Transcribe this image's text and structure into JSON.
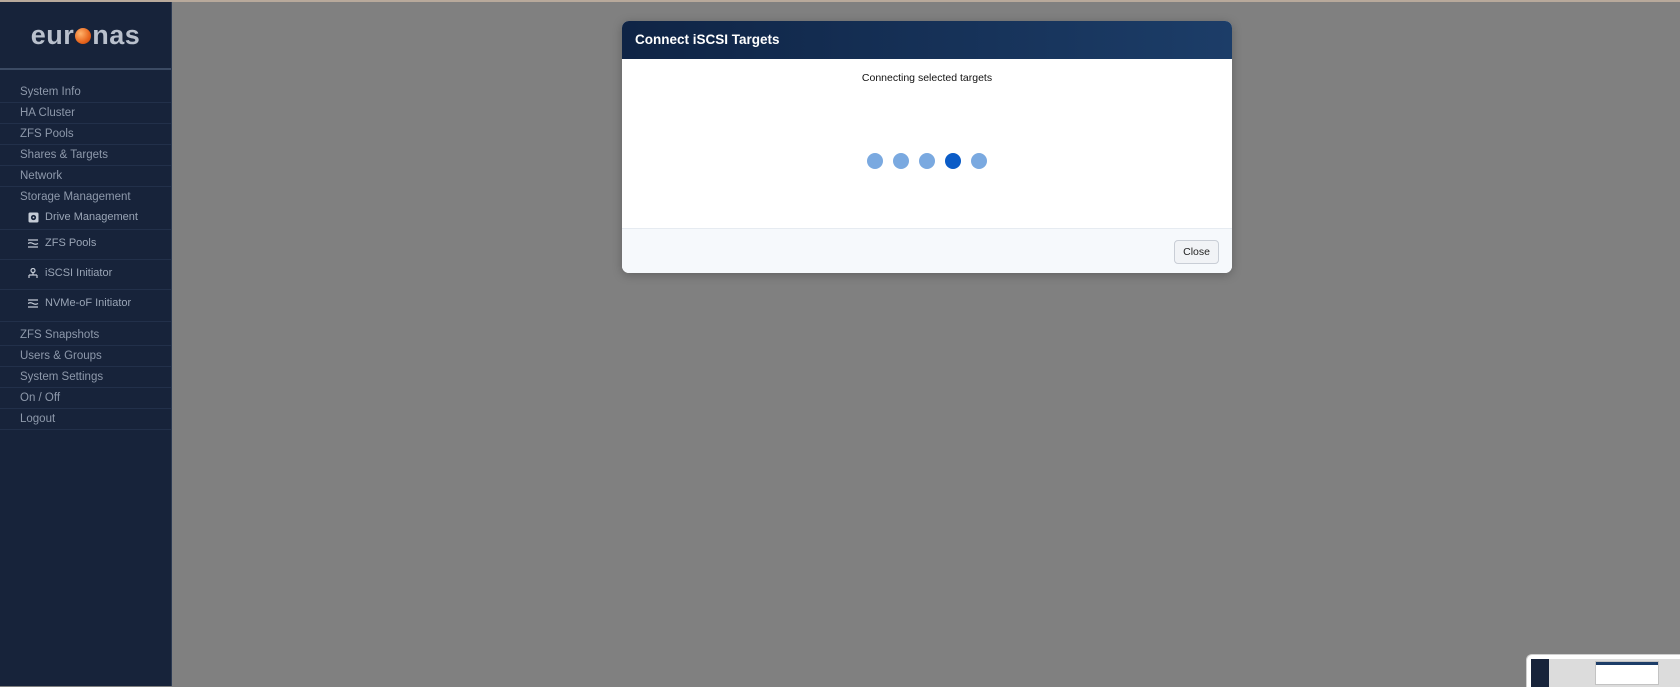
{
  "brand": {
    "logo_left": "eur",
    "logo_right": "nas"
  },
  "sidebar": {
    "items": [
      {
        "label": "System Info"
      },
      {
        "label": "HA Cluster"
      },
      {
        "label": "ZFS Pools"
      },
      {
        "label": "Shares & Targets"
      },
      {
        "label": "Network"
      },
      {
        "label": "Storage Management"
      }
    ],
    "subitems": [
      {
        "label": "Drive Management",
        "icon": "drive-icon"
      },
      {
        "label": "ZFS Pools",
        "icon": "layers-icon"
      },
      {
        "label": "iSCSI Initiator",
        "icon": "initiator-icon"
      },
      {
        "label": "NVMe-oF Initiator",
        "icon": "layers-icon"
      }
    ],
    "items_after": [
      {
        "label": "ZFS Snapshots"
      },
      {
        "label": "Users & Groups"
      },
      {
        "label": "System Settings"
      },
      {
        "label": "On / Off"
      },
      {
        "label": "Logout"
      }
    ]
  },
  "modal": {
    "title": "Connect iSCSI Targets",
    "message": "Connecting selected targets",
    "loader": {
      "dot_count": 5,
      "active_index": 3
    },
    "close_label": "Close"
  },
  "colors": {
    "sidebar_bg": "#17233a",
    "overlay": "#808080",
    "header_gradient_start": "#0f2445",
    "header_gradient_end": "#1c3d68",
    "dot_inactive": "#7aa9e0",
    "dot_active": "#0b5cc7"
  }
}
